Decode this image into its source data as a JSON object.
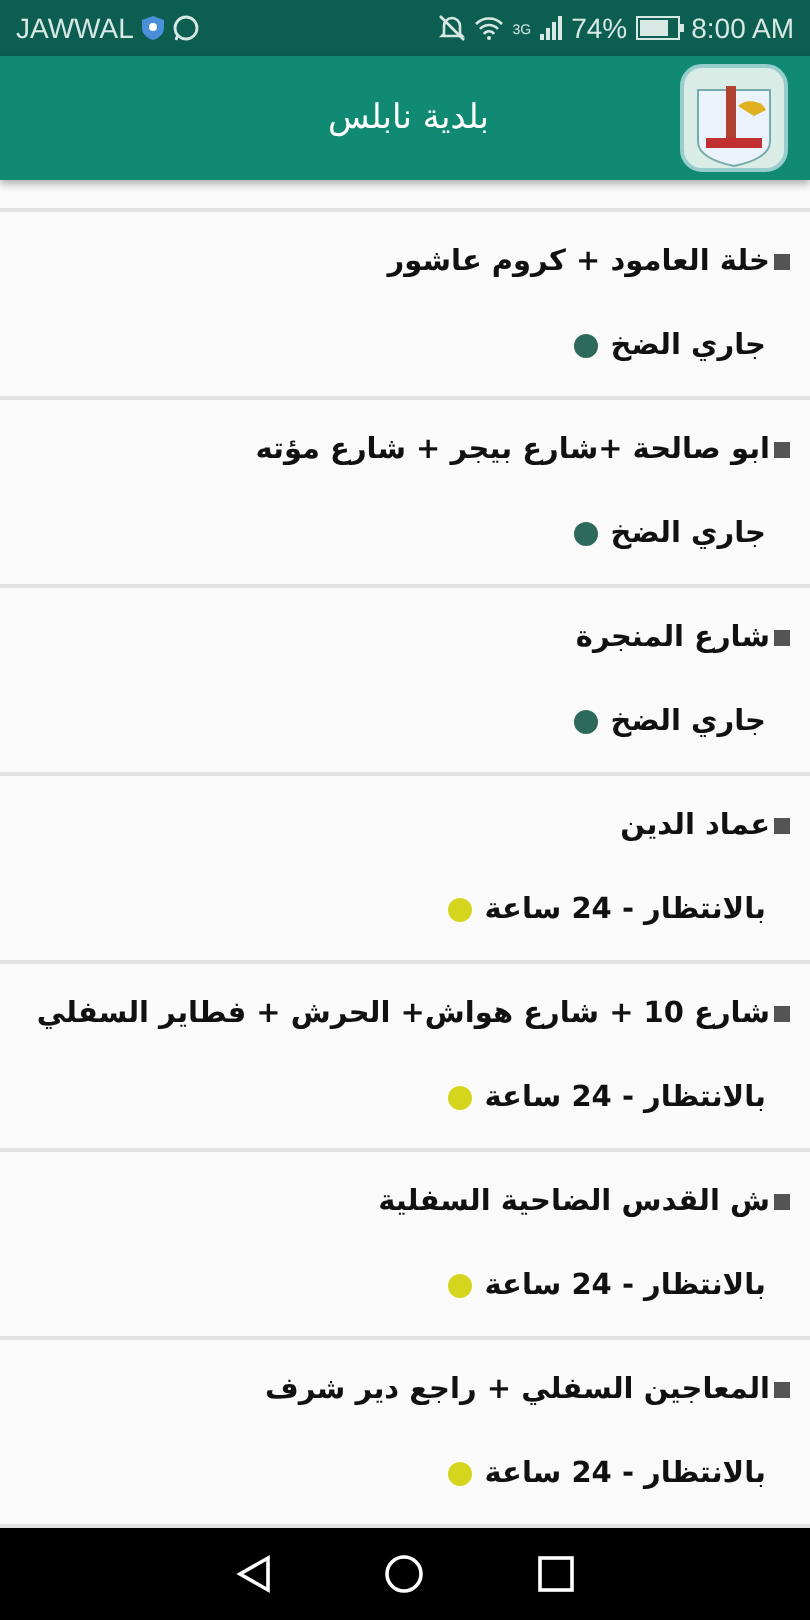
{
  "status_bar": {
    "carrier": "JAWWAL",
    "network": "3G",
    "battery": "74%",
    "time": "8:00 AM"
  },
  "app_bar": {
    "title": "بلدية نابلس"
  },
  "streets": [
    {
      "name": "خلة العامود + كروم عاشور",
      "status": "جاري الضخ",
      "color": "#2d6a5c"
    },
    {
      "name": "ابو صالحة +شارع بيجر + شارع مؤته",
      "status": "جاري الضخ",
      "color": "#2d6a5c"
    },
    {
      "name": "شارع المنجرة",
      "status": "جاري الضخ",
      "color": "#2d6a5c"
    },
    {
      "name": "عماد الدين",
      "status": "بالانتظار - 24 ساعة",
      "color": "#d6d51e"
    },
    {
      "name": "شارع 10 + شارع هواش+ الحرش + فطاير السفلي",
      "status": "بالانتظار - 24 ساعة",
      "color": "#d6d51e"
    },
    {
      "name": "ش القدس الضاحية السفلية",
      "status": "بالانتظار - 24 ساعة",
      "color": "#d6d51e"
    },
    {
      "name": "المعاجين السفلي + راجع دير شرف",
      "status": "بالانتظار - 24 ساعة",
      "color": "#d6d51e"
    }
  ]
}
